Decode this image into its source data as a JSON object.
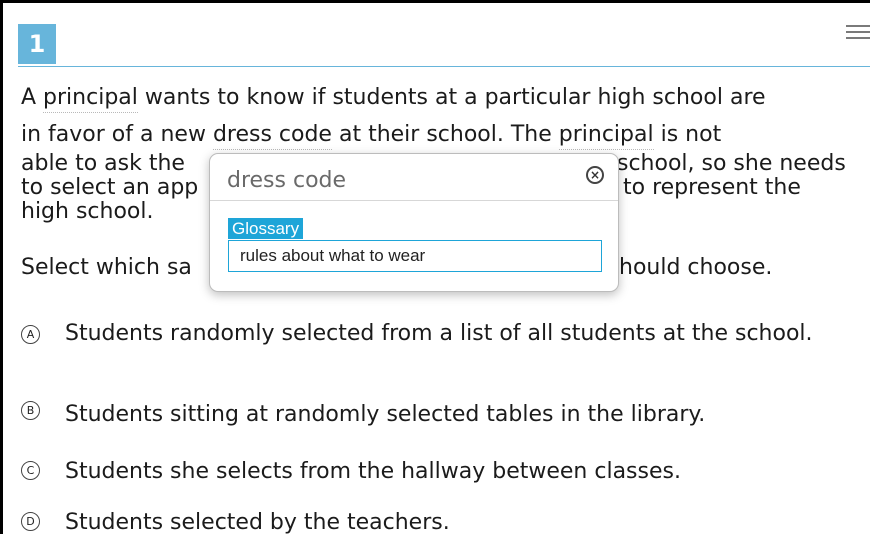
{
  "question": {
    "number": "1",
    "stem_lines": [
      [
        "A ",
        "principal",
        " wants to know if students at a particular high school are"
      ],
      [
        "in favor of a new ",
        "dress code",
        " at their school. The ",
        "principal",
        " is not"
      ],
      [
        "able to ask the",
        "school, so she needs"
      ],
      [
        "to select an app",
        "to represent the"
      ],
      [
        "high school."
      ]
    ],
    "prompt_left": "Select which sa",
    "prompt_right": "hould choose.",
    "options": [
      {
        "letter": "A",
        "text": "Students randomly selected from a list of all students at the school."
      },
      {
        "letter": "B",
        "text": "Students sitting at randomly selected tables in the library."
      },
      {
        "letter": "C",
        "text": "Students she selects from the hallway between classes."
      },
      {
        "letter": "D",
        "text": "Students selected by the teachers."
      }
    ]
  },
  "glossary_popup": {
    "title": "dress code",
    "tab_label": "Glossary",
    "definition": "rules about what to wear",
    "close_icon": "close-circle-icon"
  },
  "toolbar": {
    "menu_icon": "hamburger-menu-icon"
  },
  "colors": {
    "accent": "#67b5db",
    "glossary_accent": "#1ea5d8"
  }
}
